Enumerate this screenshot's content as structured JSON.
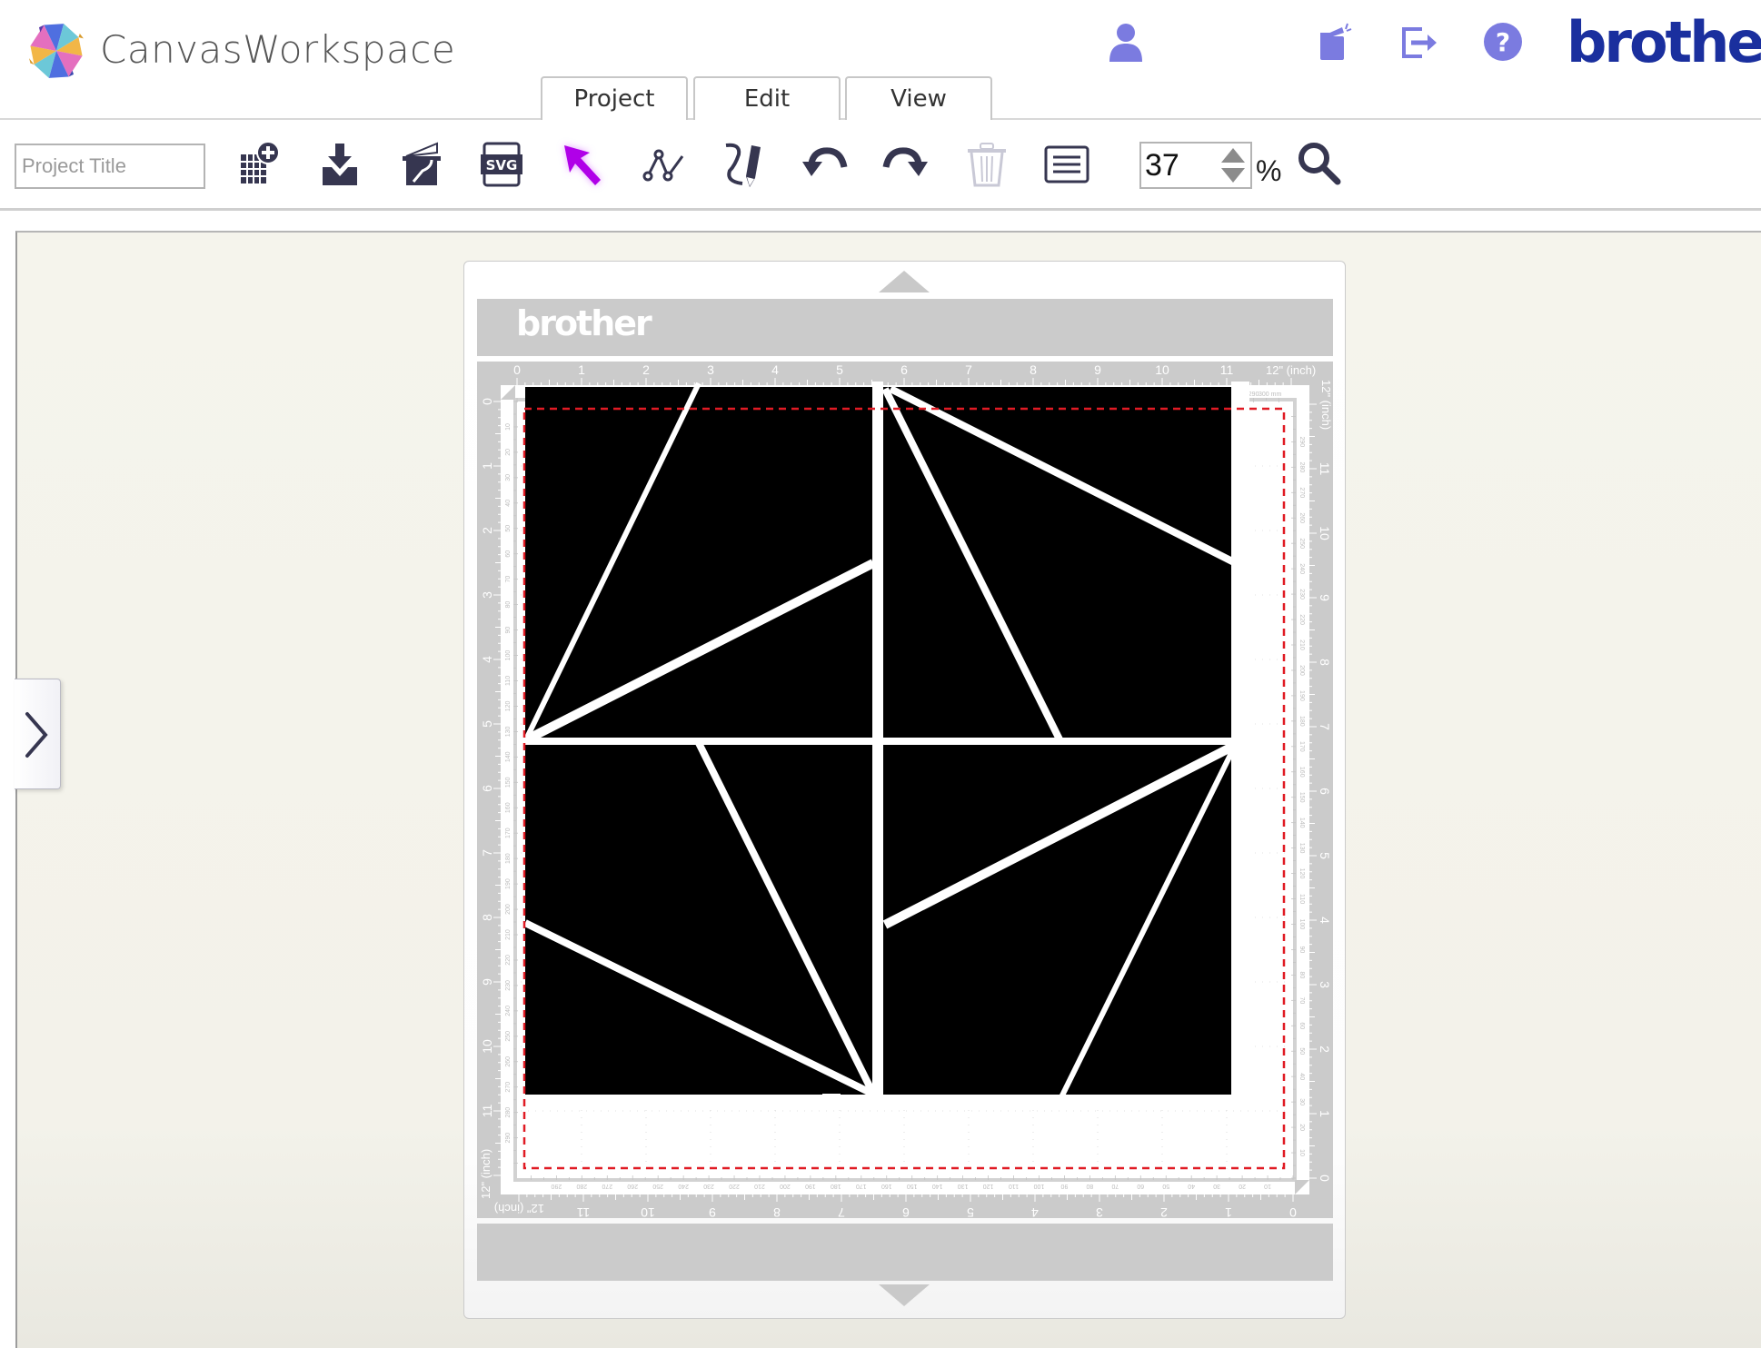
{
  "header": {
    "app_title": "CanvasWorkspace",
    "brand": "brother",
    "icons": [
      {
        "name": "user-account-icon",
        "glyph": "person"
      },
      {
        "name": "open-folder-icon",
        "glyph": "folder-open"
      },
      {
        "name": "logout-icon",
        "glyph": "exit-arrow"
      },
      {
        "name": "help-icon",
        "glyph": "question-circle"
      }
    ],
    "accent_color": "#7b7be0",
    "brand_color": "#1a2f9e"
  },
  "tabs": [
    {
      "label": "Project",
      "active": true
    },
    {
      "label": "Edit",
      "active": false
    },
    {
      "label": "View",
      "active": false
    }
  ],
  "toolbar": {
    "project_title_value": "",
    "project_title_placeholder": "Project Title",
    "tools": [
      {
        "name": "new-project-icon",
        "label": "New"
      },
      {
        "name": "download-icon",
        "label": "Download"
      },
      {
        "name": "import-image-icon",
        "label": "Import"
      },
      {
        "name": "svg-import-icon",
        "label": "SVG",
        "text": "SVG"
      },
      {
        "name": "select-arrow-icon",
        "label": "Select",
        "active": true,
        "active_color": "#b000e8"
      },
      {
        "name": "node-edit-icon",
        "label": "Edit Points"
      },
      {
        "name": "freehand-draw-icon",
        "label": "Draw"
      },
      {
        "name": "undo-icon",
        "label": "Undo"
      },
      {
        "name": "redo-icon",
        "label": "Redo"
      },
      {
        "name": "trash-icon",
        "label": "Delete",
        "disabled": true
      },
      {
        "name": "object-list-icon",
        "label": "Object List"
      }
    ],
    "zoom_value": "37",
    "zoom_unit": "%",
    "icon_color": "#363650"
  },
  "mat": {
    "brand": "brother",
    "inch_ticks_top": [
      "0",
      "1",
      "2",
      "3",
      "4",
      "5",
      "6",
      "7",
      "8",
      "9",
      "10",
      "11"
    ],
    "inch_end_label": "12\" (inch)",
    "mm_ticks": [
      "10",
      "20",
      "30",
      "40",
      "50",
      "60",
      "70",
      "80",
      "90",
      "100",
      "110",
      "120",
      "130",
      "140",
      "150",
      "160",
      "170",
      "180",
      "190",
      "200",
      "210",
      "220",
      "230",
      "240",
      "250",
      "260",
      "270",
      "280",
      "290"
    ],
    "mm_end_label": "300 mm",
    "inch_ticks_side": [
      "0",
      "1",
      "2",
      "3",
      "4",
      "5",
      "6",
      "7",
      "8",
      "9",
      "10",
      "11"
    ],
    "cut_area_border_color": "#e01b24",
    "shape_fill": "#000000",
    "shape_gap_color": "#ffffff"
  }
}
